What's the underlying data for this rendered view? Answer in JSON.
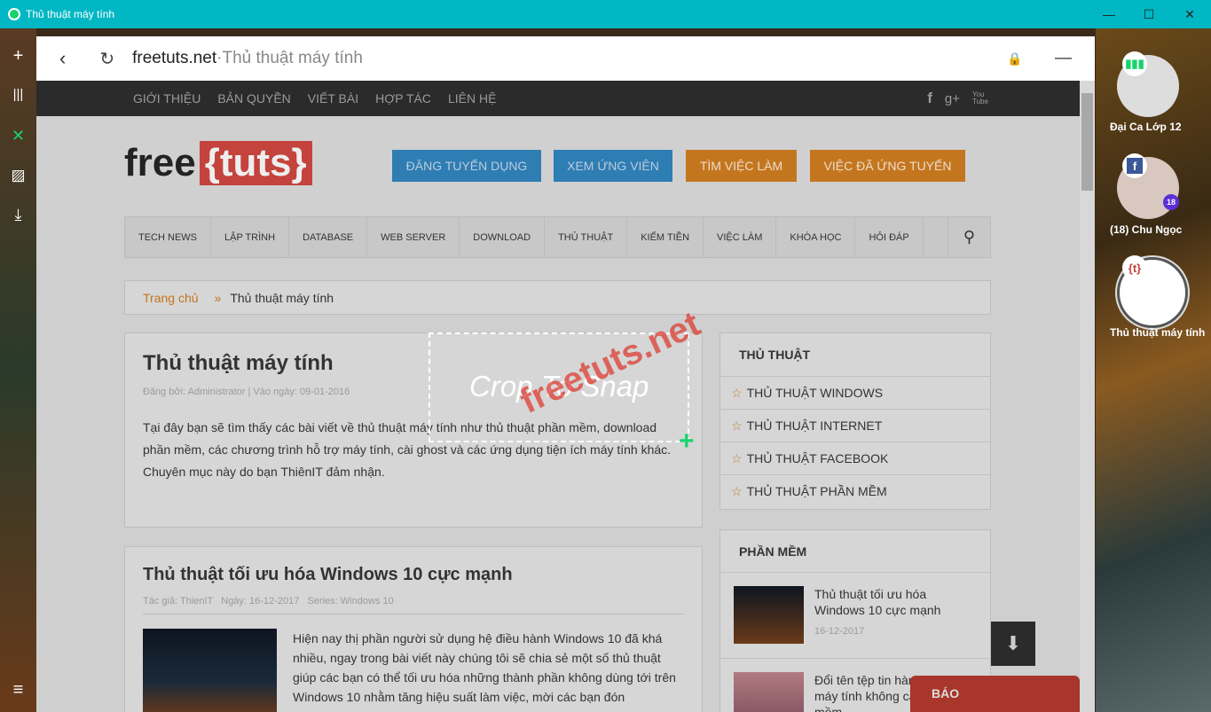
{
  "window": {
    "title": "Thủ thuật máy tính",
    "minimize": "—",
    "maximize": "☐",
    "close": "✕"
  },
  "sidebar": {
    "add": "+",
    "tabs": "|||",
    "close": "✕",
    "image": "▨",
    "download": "⤓",
    "menu": "≡"
  },
  "address": {
    "domain": "freetuts.net",
    "separator": " · ",
    "title": "Thủ thuật máy tính",
    "minimize": "—"
  },
  "top_nav": [
    "GIỚI THIỆU",
    "BẢN QUYỀN",
    "VIẾT BÀI",
    "HỢP TÁC",
    "LIÊN HỆ"
  ],
  "social": [
    "f",
    "g+",
    "You Tube"
  ],
  "logo": {
    "free": "free",
    "tuts": "{tuts}"
  },
  "header_buttons": [
    {
      "label": "ĐĂNG TUYỂN DỤNG",
      "color": "#2e7db3"
    },
    {
      "label": "XEM ỨNG VIÊN",
      "color": "#2e7db3"
    },
    {
      "label": "TÌM VIỆC LÀM",
      "color": "#c4761f"
    },
    {
      "label": "VIỆC ĐÃ ỨNG TUYỂN",
      "color": "#c4761f"
    }
  ],
  "menu": [
    "TECH NEWS",
    "LẬP TRÌNH",
    "DATABASE",
    "WEB SERVER",
    "DOWNLOAD",
    "THỦ THUẬT",
    "KIẾM TIỀN",
    "VIỆC LÀM",
    "KHÓA HỌC",
    "HỎI ĐÁP"
  ],
  "breadcrumb": {
    "home": "Trang chủ",
    "sep": "»",
    "current": "Thủ thuật máy tính"
  },
  "category": {
    "title": "Thủ thuật máy tính",
    "meta": "Đăng bởi: Administrator | Vào ngày: 09-01-2016",
    "desc": "Tại đây bạn sẽ tìm thấy các bài viết về thủ thuật máy tính như thủ thuật phần mềm, download phần mềm, các chương trình hỗ trợ máy tính, cài ghost và các ứng dụng tiện ích máy tính khác. Chuyên mục này do bạn ThiênIT  đảm nhận."
  },
  "article": {
    "title": "Thủ thuật tối ưu hóa Windows 10 cực mạnh",
    "meta": "Tác giả: ThienIT   Ngày: 16-12-2017   Series: Windows 10",
    "excerpt": "Hiện nay thị phần người sử dụng hệ điều hành Windows 10 đã khá nhiều, ngay trong bài viết này chúng tôi sẽ chia sẻ một số thủ thuật giúp các bạn có thể tối ưu hóa những thành phần không dùng tới trên Windows 10 nhằm tăng hiệu suất làm việc, mời các bạn đón"
  },
  "widget_tips": {
    "title": "THỦ THUẬT",
    "items": [
      "THỦ THUẬT WINDOWS",
      "THỦ THUẬT INTERNET",
      "THỦ THUẬT FACEBOOK",
      "THỦ THUẬT PHẦN MỀM"
    ]
  },
  "widget_software": {
    "title": "PHẦN MỀM",
    "items": [
      {
        "title": "Thủ thuật tối ưu hóa Windows 10 cực mạnh",
        "date": "16-12-2017"
      },
      {
        "title": "Đổi tên tệp tin hàng loạt trên máy tính không cần phần mềm",
        "date": ""
      }
    ]
  },
  "report_button": "BÁO",
  "crop": {
    "label": "Crop To Snap",
    "watermark": "freetuts.net"
  },
  "tabs_panel": [
    {
      "label": "Đại Ca Lớp 12",
      "badge": "▮▮▮"
    },
    {
      "label": "(18) Chu Ngọc",
      "badge": "f",
      "count": "18"
    },
    {
      "label": "Thủ thuật máy tính",
      "badge": "{t}"
    }
  ]
}
